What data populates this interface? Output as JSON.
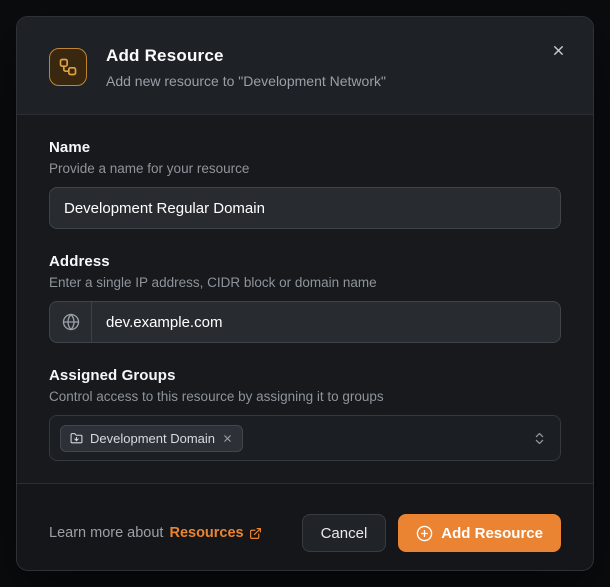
{
  "colors": {
    "accent_orange": "#EB8432"
  },
  "dialog": {
    "title": "Add Resource",
    "subtitle": "Add new resource to \"Development Network\"",
    "header_icon": "workflow-icon",
    "close_icon": "x-icon"
  },
  "form": {
    "name": {
      "label": "Name",
      "helper": "Provide a name for your resource",
      "value": "Development Regular Domain"
    },
    "address": {
      "label": "Address",
      "helper": "Enter a single IP address, CIDR block or domain name",
      "value": "dev.example.com",
      "prefix_icon": "globe-icon"
    },
    "groups": {
      "label": "Assigned Groups",
      "helper": "Control access to this resource by assigning it to groups",
      "selected": [
        {
          "label": "Development Domain",
          "icon": "folder-down-icon"
        }
      ],
      "dropdown_icon": "chevrons-up-down-icon"
    }
  },
  "footer": {
    "learn_more_prefix": "Learn more about",
    "learn_more_link": "Resources",
    "link_icon": "external-link-icon",
    "cancel_label": "Cancel",
    "submit_label": "Add Resource",
    "submit_icon": "plus-circle-icon"
  }
}
